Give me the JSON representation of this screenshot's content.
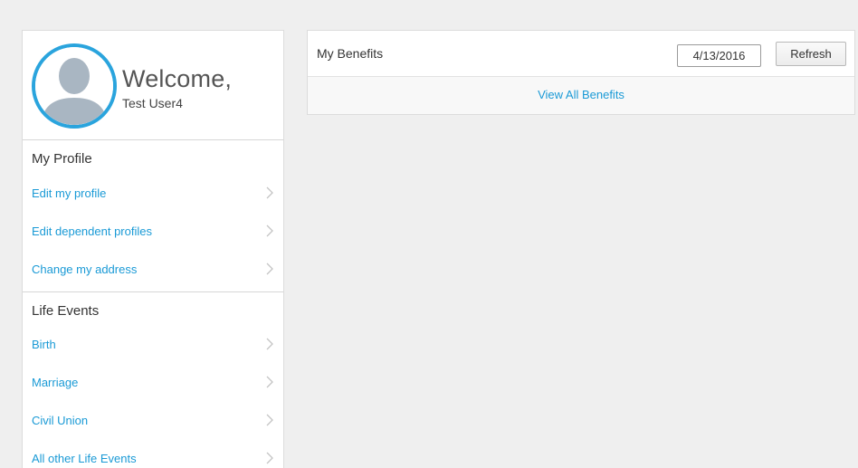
{
  "welcome": {
    "title": "Welcome,",
    "user_name": "Test User4"
  },
  "sidebar": {
    "sections": [
      {
        "heading": "My Profile",
        "items": [
          "Edit my profile",
          "Edit dependent profiles",
          "Change my address"
        ]
      },
      {
        "heading": "Life Events",
        "items": [
          "Birth",
          "Marriage",
          "Civil Union",
          "All other Life Events"
        ]
      }
    ]
  },
  "benefits": {
    "title": "My Benefits",
    "date_value": "4/13/2016",
    "refresh_label": "Refresh",
    "view_all_label": "View All Benefits"
  },
  "icons": {
    "avatar": "user-silhouette-icon",
    "chevron": "chevron-right-icon"
  },
  "colors": {
    "accent": "#1a9ad6",
    "avatar_ring": "#2aa4dd",
    "avatar_figure": "#a9b6c2",
    "background": "#efefef"
  }
}
